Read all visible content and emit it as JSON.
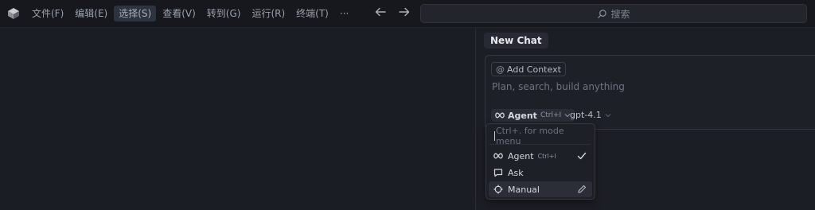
{
  "menu": {
    "items": [
      "文件(F)",
      "编辑(E)",
      "选择(S)",
      "查看(V)",
      "转到(G)",
      "运行(R)",
      "终端(T)",
      "···"
    ]
  },
  "search": {
    "label": "搜索"
  },
  "chat": {
    "tab_label": "New Chat",
    "add_context": "Add Context",
    "placeholder": "Plan, search, build anything",
    "mode": {
      "label": "Agent",
      "shortcut": "Ctrl+I"
    },
    "model": "gpt-4.1"
  },
  "mode_menu": {
    "search_placeholder": "Ctrl+. for mode menu",
    "items": [
      {
        "label": "Agent",
        "shortcut": "Ctrl+I",
        "icon": "infinity-icon",
        "selected": true
      },
      {
        "label": "Ask",
        "icon": "chat-bubble-icon"
      },
      {
        "label": "Manual",
        "icon": "crosshair-icon",
        "trailing": "pencil-icon"
      }
    ]
  },
  "colors": {
    "background": "#1b1d24",
    "titlebar": "#17181e",
    "accent_text": "#e6e8ec"
  }
}
